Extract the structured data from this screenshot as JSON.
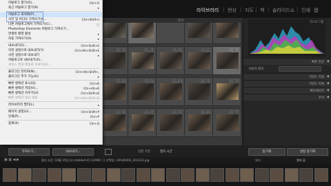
{
  "menu": {
    "items": [
      {
        "label": "카탈로그 열기(O)...",
        "shortcut": "Ctrl+O",
        "type": "item"
      },
      {
        "label": "최근 카탈로그 열기(R)",
        "shortcut": "",
        "type": "submenu",
        "dim": false
      },
      {
        "type": "sep"
      },
      {
        "label": "카탈로그 최적화(P)...",
        "shortcut": "",
        "type": "item",
        "highlight": true
      },
      {
        "label": "사진 및 비디오 가져오기(I)...",
        "shortcut": "Ctrl+Shift+I",
        "type": "item"
      },
      {
        "label": "다른 카탈로그에서 가져오기(C)...",
        "shortcut": "",
        "type": "item"
      },
      {
        "label": "Photoshop Elements 카탈로그 가져오기...",
        "shortcut": "",
        "type": "item"
      },
      {
        "label": "연결된 촬영 활성",
        "shortcut": "",
        "type": "submenu"
      },
      {
        "label": "자동 가져오기(A)",
        "shortcut": "",
        "type": "submenu"
      },
      {
        "type": "sep"
      },
      {
        "label": "내보내기(E)...",
        "shortcut": "Ctrl+Shift+E",
        "type": "item"
      },
      {
        "label": "이전 설정으로 내보내기(Y)",
        "shortcut": "Ctrl+Alt+Shift+E",
        "type": "item"
      },
      {
        "label": "사전 설정으로 내보내기",
        "shortcut": "",
        "type": "submenu"
      },
      {
        "label": "카탈로그로 내보내기(X)...",
        "shortcut": "",
        "type": "item"
      },
      {
        "label": "서비스 전자 메일로 보내기(X)...",
        "shortcut": "",
        "type": "item",
        "dim": true
      },
      {
        "type": "sep"
      },
      {
        "label": "플러그인 관리자(N)...",
        "shortcut": "Ctrl+Alt+Shift+,",
        "type": "item"
      },
      {
        "label": "플러그인 추가 기능(G)",
        "shortcut": "",
        "type": "submenu"
      },
      {
        "type": "sep"
      },
      {
        "label": "빠른 컬렉션 표시(Q)",
        "shortcut": "Ctrl+B",
        "type": "item"
      },
      {
        "label": "빠른 컬렉션 저장(V)...",
        "shortcut": "Ctrl+Alt+B",
        "type": "item"
      },
      {
        "label": "빠른 컬렉션 지우기(U)",
        "shortcut": "Ctrl+Shift+B",
        "type": "item"
      },
      {
        "label": "빠른 컬렉션 대상 설정",
        "shortcut": "Ctrl+Alt+Shift+B",
        "type": "item",
        "dim": true
      },
      {
        "type": "sep"
      },
      {
        "label": "라이브러리 필터(L)",
        "shortcut": "",
        "type": "submenu"
      },
      {
        "type": "sep"
      },
      {
        "label": "페이지 설정(U)...",
        "shortcut": "Ctrl+Shift+P",
        "type": "item"
      },
      {
        "label": "인쇄(P)...",
        "shortcut": "Ctrl+P",
        "type": "item"
      },
      {
        "type": "sep"
      },
      {
        "label": "종료(X)",
        "shortcut": "Ctrl+Q",
        "type": "item"
      }
    ]
  },
  "modules": [
    {
      "label": "라이브러리",
      "active": true
    },
    {
      "label": "현상",
      "active": false
    },
    {
      "label": "지도",
      "active": false
    },
    {
      "label": "책",
      "active": false
    },
    {
      "label": "슬라이드쇼",
      "active": false
    },
    {
      "label": "인쇄",
      "active": false
    },
    {
      "label": "웹",
      "active": false
    }
  ],
  "filter_bar": {
    "label": "문서"
  },
  "grid": {
    "cells": [
      {
        "num": "48",
        "sel": false,
        "photo": "#6f6a62"
      },
      {
        "num": "49",
        "sel": true,
        "photo": "#8f7d6d"
      },
      {
        "num": "50",
        "sel": false,
        "photo": ""
      },
      {
        "num": "51",
        "sel": false,
        "photo": "#615a52"
      },
      {
        "num": "52",
        "sel": false,
        "photo": "#7c6a58"
      },
      {
        "num": "53",
        "sel": false,
        "photo": "#4f4a45"
      },
      {
        "num": "54",
        "sel": false,
        "photo": "#8a7a68"
      },
      {
        "num": "55",
        "sel": false,
        "photo": "#6a5e54"
      },
      {
        "num": "56",
        "sel": false,
        "photo": "#705e50"
      },
      {
        "num": "57",
        "sel": true,
        "photo": "#5d5048"
      },
      {
        "num": "58",
        "sel": false,
        "photo": "#6a5a4c"
      },
      {
        "num": "59",
        "sel": false,
        "photo": "#584c44"
      },
      {
        "num": "60",
        "sel": false,
        "photo": "#6c5a4a"
      },
      {
        "num": "61",
        "sel": false,
        "photo": "#4e4640"
      },
      {
        "num": "62",
        "sel": false,
        "photo": "#b89a6e"
      },
      {
        "num": "63",
        "sel": false,
        "photo": "#725f4f"
      },
      {
        "num": "64",
        "sel": false,
        "photo": "#7a6858"
      },
      {
        "num": "65",
        "sel": false,
        "photo": "#5a4e46"
      },
      {
        "num": "66",
        "sel": false,
        "photo": "#705c4c"
      },
      {
        "num": "67",
        "sel": false,
        "photo": "#685848"
      }
    ]
  },
  "right_panel": {
    "histogram_title": "히스토그램",
    "quick_develop": "빠른 현상",
    "keywording": "키워드 지정",
    "keyword_list": "키워드 목록",
    "metadata": "메타데이터",
    "comments": "주석",
    "custom_label": "사용자 정의",
    "sync_button": "동기화",
    "sync_settings_button": "설정 동기화"
  },
  "toolbar": {
    "import_button": "가져오기...",
    "export_button": "내보내기...",
    "sort_label": "정렬 기준:",
    "sort_value": "캡처 시간"
  },
  "filmstrip": {
    "info": "필터 사진: 10월 15일 [오 mobile으로] 12969 / 1 선택됨 / 20180303_203131.jpg",
    "filter_label": "필터:",
    "filter_value": "필터 끔"
  },
  "colors": {
    "accent": "#cfe3fb",
    "panel": "#262626",
    "menu_bg": "#f0f0f0"
  }
}
